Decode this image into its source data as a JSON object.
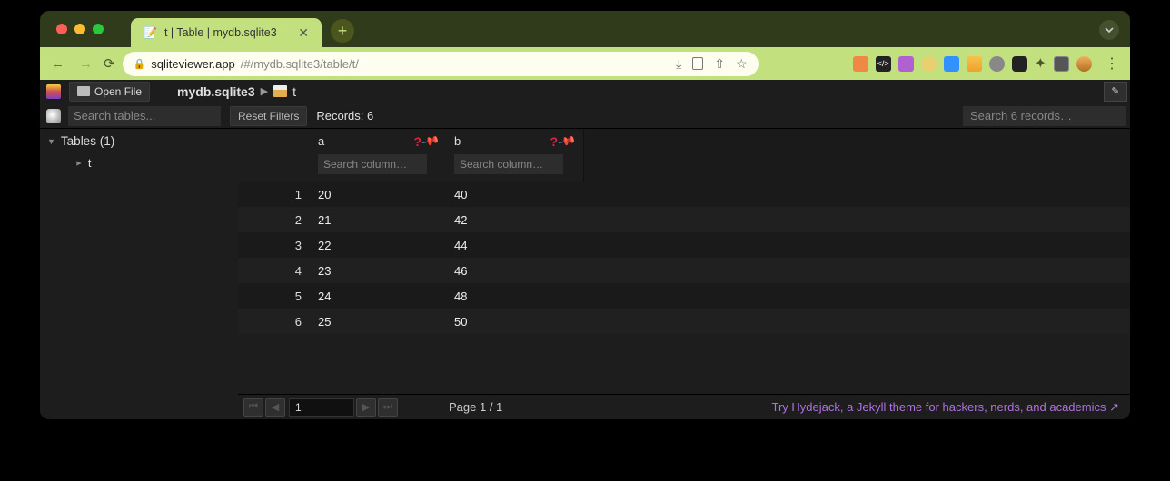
{
  "browser": {
    "tab_title": "t | Table | mydb.sqlite3",
    "url_host": "sqliteviewer.app",
    "url_path": "/#/mydb.sqlite3/table/t/"
  },
  "app": {
    "open_file_label": "Open File",
    "breadcrumb": {
      "db": "mydb.sqlite3",
      "table": "t"
    },
    "search_tables_placeholder": "Search tables...",
    "reset_filters_label": "Reset Filters",
    "records_label": "Records: 6",
    "search_records_placeholder": "Search 6 records…",
    "sidebar": {
      "header": "Tables (1)",
      "items": [
        {
          "name": "t"
        }
      ]
    },
    "columns": [
      {
        "name": "a",
        "filter_placeholder": "Search column…"
      },
      {
        "name": "b",
        "filter_placeholder": "Search column…"
      }
    ],
    "rows": [
      {
        "idx": "1",
        "a": "20",
        "b": "40"
      },
      {
        "idx": "2",
        "a": "21",
        "b": "42"
      },
      {
        "idx": "3",
        "a": "22",
        "b": "44"
      },
      {
        "idx": "4",
        "a": "23",
        "b": "46"
      },
      {
        "idx": "5",
        "a": "24",
        "b": "48"
      },
      {
        "idx": "6",
        "a": "25",
        "b": "50"
      }
    ],
    "footer": {
      "page_input": "1",
      "page_label": "Page 1 / 1",
      "promo": "Try Hydejack, a Jekyll theme for hackers, nerds, and academics ↗"
    }
  }
}
